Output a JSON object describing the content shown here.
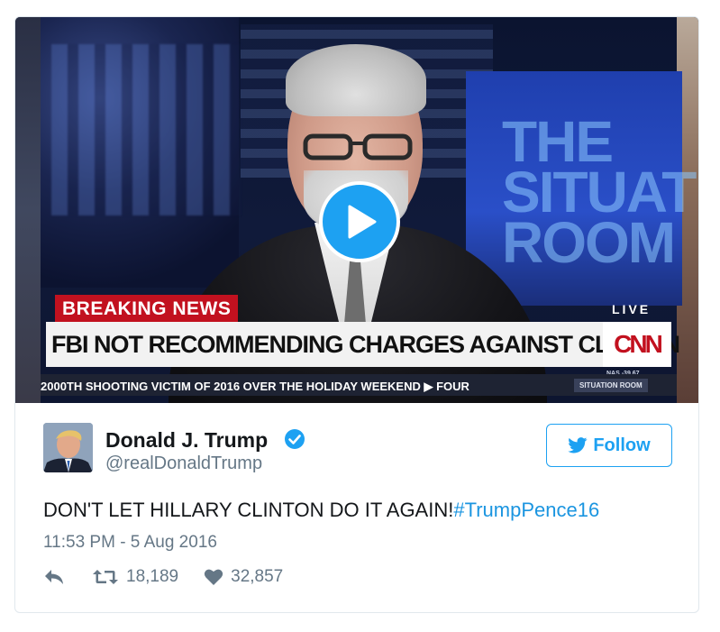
{
  "video": {
    "breaking_label": "BREAKING NEWS",
    "live_label": "LIVE",
    "headline": "FBI NOT RECOMMENDING CHARGES AGAINST CLINTON",
    "network_logo": "CNN",
    "market_text": "NAS  -39.67",
    "ticker": "2000TH SHOOTING VICTIM OF 2016 OVER THE HOLIDAY WEEKEND   ▶ FOUR",
    "program_tag": "SITUATION ROOM",
    "background_text": "THE SITUATION ROOM",
    "play_icon": "play-icon"
  },
  "tweet": {
    "display_name": "Donald J. Trump",
    "handle": "@realDonaldTrump",
    "verified_icon": "verified-badge-icon",
    "follow_label": "Follow",
    "text": "DON'T LET HILLARY CLINTON DO IT AGAIN!",
    "hashtag": "#TrumpPence16",
    "timestamp": "11:53 PM - 5 Aug 2016",
    "retweets": "18,189",
    "likes": "32,857"
  },
  "colors": {
    "accent": "#1da1f2",
    "cnn_red": "#c2111f",
    "text": "#14171a",
    "muted": "#657786",
    "border": "#e1e8ed"
  }
}
